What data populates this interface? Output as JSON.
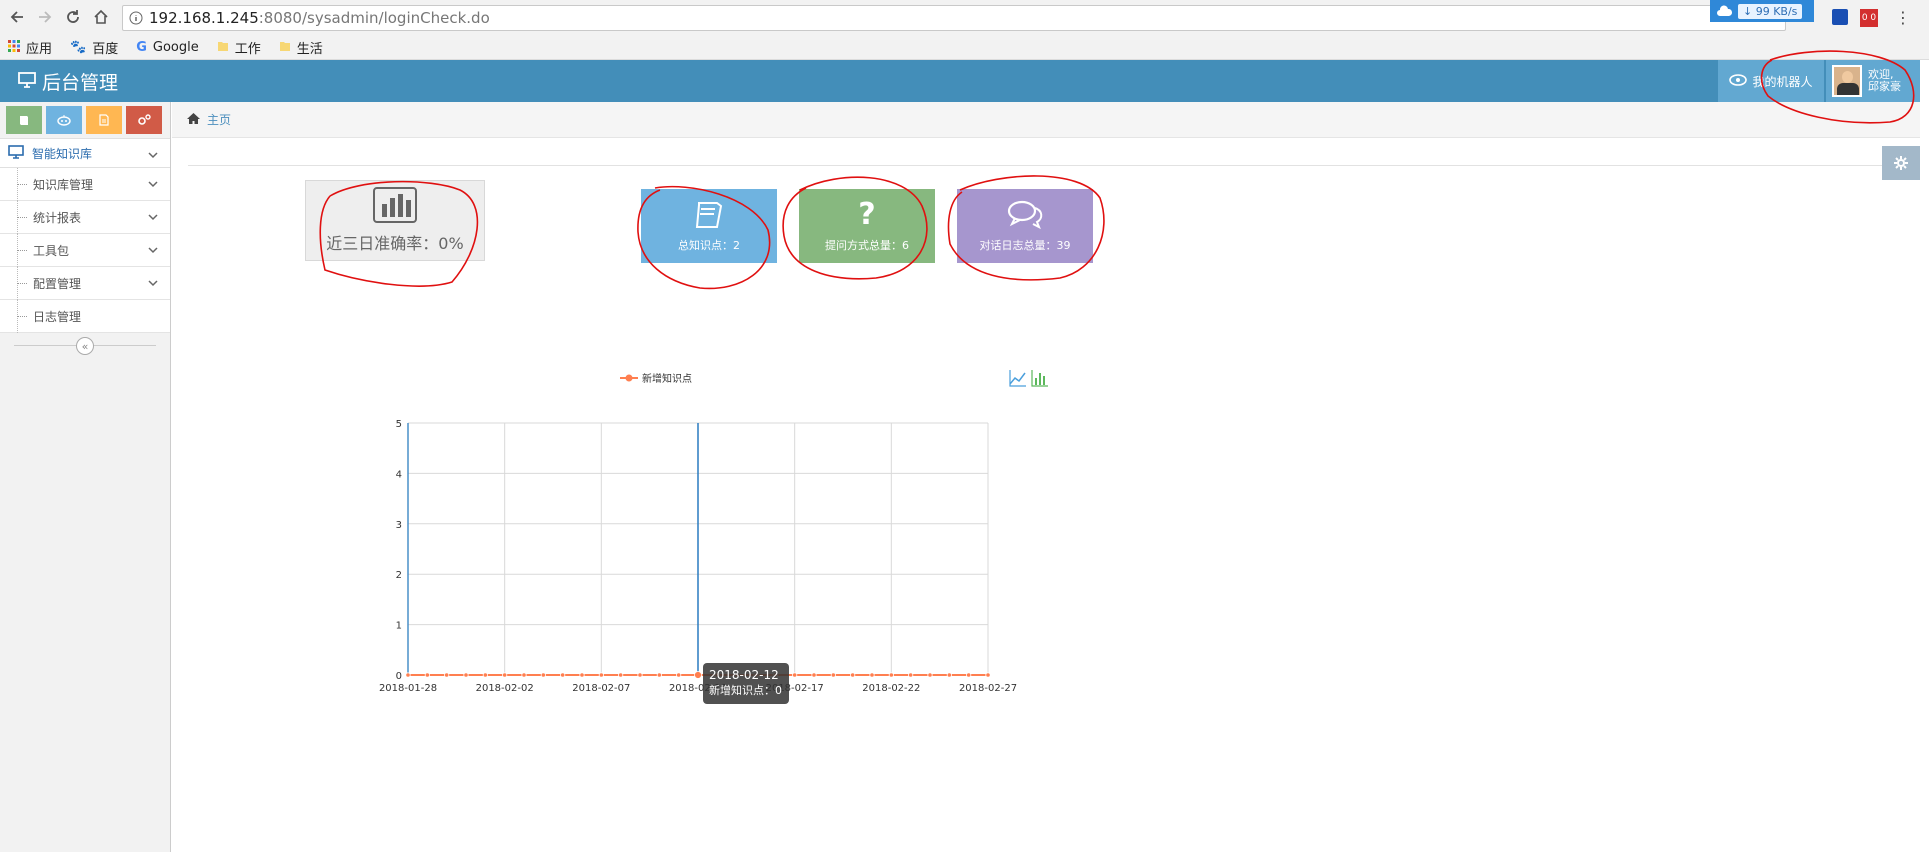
{
  "browser": {
    "url_host": "192.168.1.245",
    "url_path": ":8080/sysadmin/loginCheck.do",
    "download_speed": "99 KB/s",
    "bookmarks": [
      "应用",
      "百度",
      "Google",
      "工作",
      "生活"
    ]
  },
  "header": {
    "title": "后台管理",
    "robot_label": "我的机器人",
    "greeting_line1": "欢迎,",
    "greeting_line2": "邱家豪"
  },
  "sidebar": {
    "shortcuts": [
      {
        "icon": "book-icon",
        "color": "#87b87f"
      },
      {
        "icon": "robot-icon",
        "color": "#6fb3e0"
      },
      {
        "icon": "document-icon",
        "color": "#ffb752"
      },
      {
        "icon": "gears-icon",
        "color": "#d15b47"
      }
    ],
    "top_menu": "智能知识库",
    "items": [
      {
        "label": "知识库管理",
        "has_children": true
      },
      {
        "label": "统计报表",
        "has_children": true
      },
      {
        "label": "工具包",
        "has_children": true
      },
      {
        "label": "配置管理",
        "has_children": true
      },
      {
        "label": "日志管理",
        "has_children": false
      }
    ]
  },
  "breadcrumb": {
    "home": "主页"
  },
  "stats": {
    "accuracy_label": "近三日准确率：0%",
    "tiles": [
      {
        "label": "总知识点：2",
        "color": "#6fb3e0",
        "icon": "book-icon"
      },
      {
        "label": "提问方式总量：6",
        "color": "#87b87f",
        "icon": "question-icon"
      },
      {
        "label": "对话日志总量：39",
        "color": "#a696ce",
        "icon": "chat-bubbles-icon"
      }
    ]
  },
  "chart_data": {
    "type": "line",
    "title": "",
    "legend": [
      "新增知识点"
    ],
    "legend_position": "top-center",
    "xlabel": "",
    "ylabel": "",
    "x_tick_labels": [
      "2018-01-28",
      "2018-02-02",
      "2018-02-07",
      "2018-02-12",
      "2018-02-17",
      "2018-02-22",
      "2018-02-27"
    ],
    "x": [
      "2018-01-28",
      "2018-01-29",
      "2018-01-30",
      "2018-01-31",
      "2018-02-01",
      "2018-02-02",
      "2018-02-03",
      "2018-02-04",
      "2018-02-05",
      "2018-02-06",
      "2018-02-07",
      "2018-02-08",
      "2018-02-09",
      "2018-02-10",
      "2018-02-11",
      "2018-02-12",
      "2018-02-13",
      "2018-02-14",
      "2018-02-15",
      "2018-02-16",
      "2018-02-17",
      "2018-02-18",
      "2018-02-19",
      "2018-02-20",
      "2018-02-21",
      "2018-02-22",
      "2018-02-23",
      "2018-02-24",
      "2018-02-25",
      "2018-02-26",
      "2018-02-27"
    ],
    "series": [
      {
        "name": "新增知识点",
        "color": "#ff7f50",
        "values": [
          0,
          0,
          0,
          0,
          0,
          0,
          0,
          0,
          0,
          0,
          0,
          0,
          0,
          0,
          0,
          0,
          0,
          0,
          0,
          0,
          0,
          0,
          0,
          0,
          0,
          0,
          0,
          0,
          0,
          0,
          0
        ]
      }
    ],
    "ylim": [
      0,
      5
    ],
    "y_ticks": [
      0,
      1,
      2,
      3,
      4,
      5
    ],
    "grid": true,
    "tooltip": {
      "date": "2018-02-12",
      "text": "新增知识点：0"
    },
    "toolbox_icons": [
      "line-chart-icon",
      "bar-chart-icon"
    ]
  }
}
